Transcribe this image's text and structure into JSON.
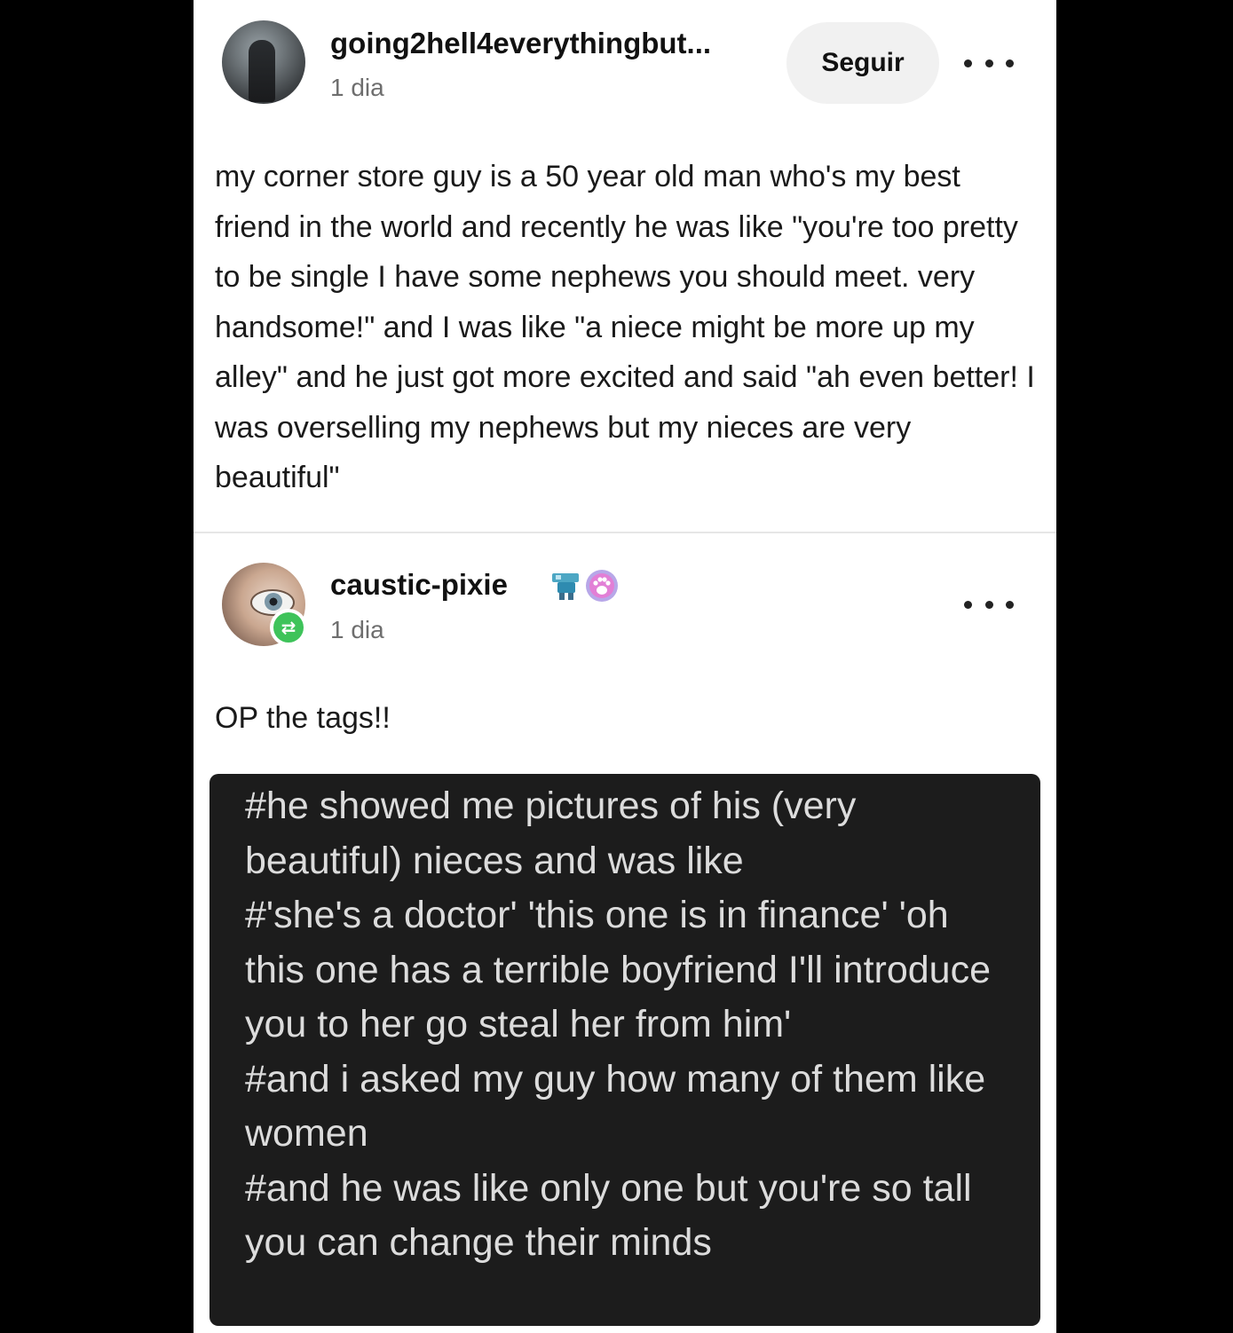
{
  "post": {
    "username": "going2hell4everythingbut...",
    "timestamp": "1 dia",
    "follow_label": "Seguir",
    "body": "my corner store guy is a 50 year old man who's my best friend in the world and recently he was like \"you're too pretty to be single I have some nephews you should meet. very handsome!\" and I was like \"a niece might be more up my alley\" and he just got more excited and said \"ah even better! I was overselling my nephews but my nieces are very beautiful\""
  },
  "reblog": {
    "username": "caustic-pixie",
    "timestamp": "1 dia",
    "badges": [
      "robot-badge-icon",
      "paw-badge-icon"
    ],
    "body": "OP the tags!!",
    "tags": [
      "#he showed me pictures of his (very beautiful) nieces and was like",
      "#'she's a doctor' 'this one is in finance' 'oh this one has a terrible boyfriend I'll introduce you to her go steal her from him'",
      "#and i asked my guy how many of them like women",
      "#and he was like only one but you're so tall you can change their minds"
    ]
  },
  "colors": {
    "page_background": "#000000",
    "card_background": "#ffffff",
    "tags_background": "#1c1c1c",
    "reblog_badge": "#3ec35a",
    "follow_button": "#f1f1f1"
  }
}
